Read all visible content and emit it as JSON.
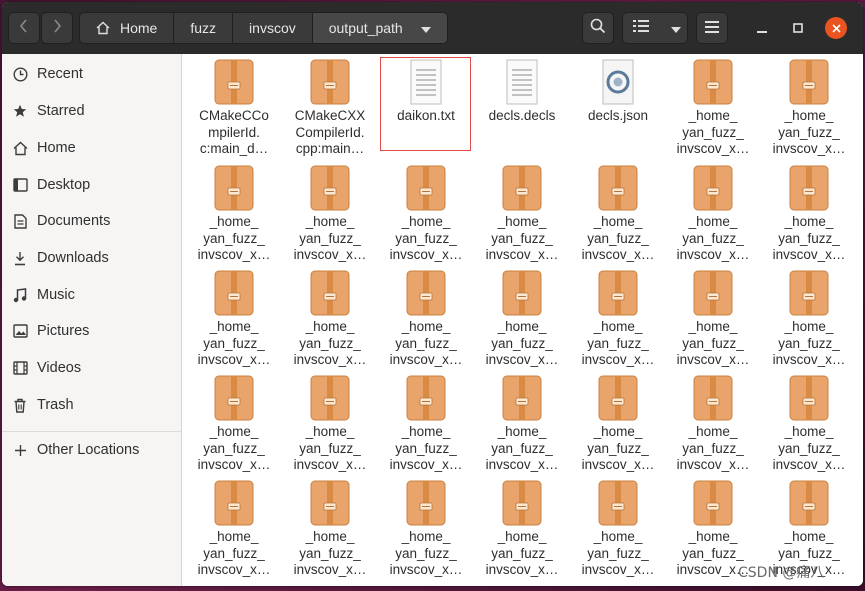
{
  "header": {
    "back_icon": "chevron-left-icon",
    "forward_icon": "chevron-right-icon",
    "breadcrumbs": [
      "Home",
      "fuzz",
      "invscov",
      "output_path"
    ],
    "search_icon": "search-icon",
    "view_list_icon": "list-view-icon",
    "view_dropdown_icon": "chevron-down-icon",
    "menu_icon": "hamburger-menu-icon",
    "minimize_icon": "minimize-icon",
    "maximize_icon": "maximize-icon",
    "close_icon": "close-icon",
    "close_color": "#e95420"
  },
  "sidebar": {
    "items": [
      {
        "label": "Recent",
        "icon": "clock-icon"
      },
      {
        "label": "Starred",
        "icon": "star-icon"
      },
      {
        "label": "Home",
        "icon": "home-icon"
      },
      {
        "label": "Desktop",
        "icon": "desktop-icon"
      },
      {
        "label": "Documents",
        "icon": "document-icon"
      },
      {
        "label": "Downloads",
        "icon": "download-icon"
      },
      {
        "label": "Music",
        "icon": "music-icon"
      },
      {
        "label": "Pictures",
        "icon": "picture-icon"
      },
      {
        "label": "Videos",
        "icon": "video-icon"
      },
      {
        "label": "Trash",
        "icon": "trash-icon"
      }
    ],
    "other_locations": {
      "label": "Other Locations",
      "icon": "plus-icon"
    }
  },
  "files": [
    {
      "name": "CMakeCCompilerId.c:main_d…",
      "lines": [
        "CMakeCCo",
        "mpilerId.",
        "c:main_d…"
      ],
      "type": "archive"
    },
    {
      "name": "CMakeCXXCompilerId.cpp:main…",
      "lines": [
        "CMakeCXX",
        "CompilerId.",
        "cpp:main…"
      ],
      "type": "archive"
    },
    {
      "name": "daikon.txt",
      "lines": [
        "daikon.txt"
      ],
      "type": "text"
    },
    {
      "name": "decls.decls",
      "lines": [
        "decls.decls"
      ],
      "type": "text"
    },
    {
      "name": "decls.json",
      "lines": [
        "decls.json"
      ],
      "type": "json"
    },
    {
      "name": "_home_yan_fuzz_invscov_x…",
      "lines": [
        "_home_",
        "yan_fuzz_",
        "invscov_x…"
      ],
      "type": "archive"
    },
    {
      "name": "_home_yan_fuzz_invscov_x…",
      "lines": [
        "_home_",
        "yan_fuzz_",
        "invscov_x…"
      ],
      "type": "archive"
    }
  ],
  "repeated_file": {
    "lines": [
      "_home_",
      "yan_fuzz_",
      "invscov_x…"
    ],
    "type": "archive"
  },
  "repeated_rows": 4,
  "highlighted_file": "daikon.txt",
  "highlight_color": "#e14b4b",
  "archive_color": "#e8a46a",
  "watermark": "CSDN @痛八"
}
